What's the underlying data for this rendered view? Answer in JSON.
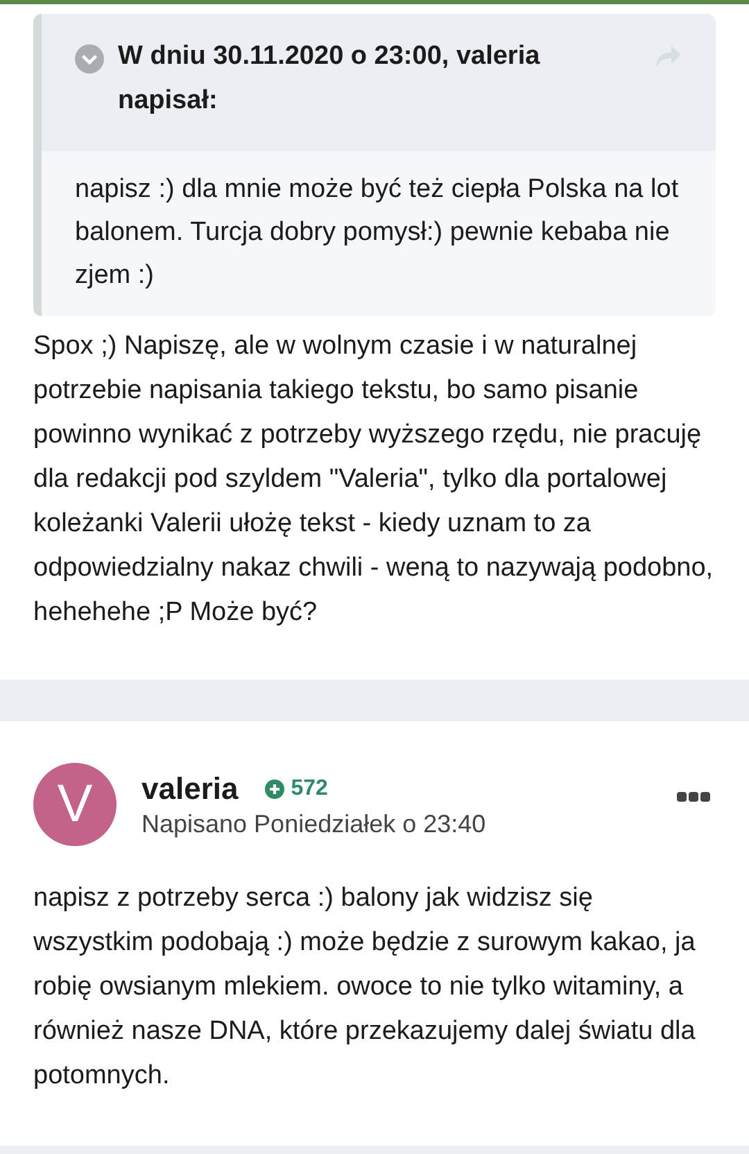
{
  "posts": [
    {
      "kind": "reply",
      "quote": {
        "header": "W dniu 30.11.2020 o 23:00, valeria napisał:",
        "text": "napisz :) dla mnie może być też ciepła Polska na lot balonem. Turcja dobry pomysł:) pewnie kebaba nie zjem :)"
      },
      "text": "Spox ;) Napiszę, ale w wolnym czasie i w naturalnej potrzebie napisania takiego tekstu, bo samo pisanie powinno wynikać z potrzeby wyższego rzędu, nie pracuję dla redakcji pod szyldem \"Valeria\", tylko dla portalowej koleżanki Valerii ułożę tekst - kiedy uznam to za odpowiedzialny nakaz chwili - weną to nazywają podobno, hehehehe ;P Może być?"
    },
    {
      "kind": "post",
      "author": {
        "initial": "V",
        "name": "valeria",
        "color": "#c4638a",
        "reputation": "572"
      },
      "meta": "Napisano Poniedziałek o 23:40",
      "text": "napisz z potrzeby serca :) balony jak widzisz się wszystkim podobają :) może będzie z surowym kakao, ja robię owsianym mlekiem. owoce to nie tylko witaminy, a również nasze DNA, które przekazujemy dalej światu dla potomnych."
    }
  ]
}
